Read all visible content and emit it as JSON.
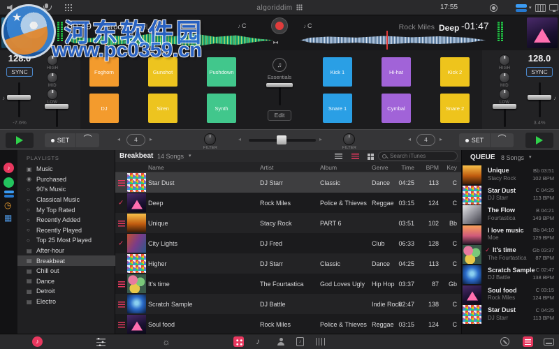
{
  "accent_color": "#e8385f",
  "watermark": {
    "line1": "河东软件园",
    "line2": "www.pc0359.cn"
  },
  "menubar": {
    "title": "algoriddim",
    "time": "17:55"
  },
  "deck_left": {
    "elapsed": "00:49",
    "title": "Groove",
    "artist": "Joel",
    "key": "C",
    "bpm": "128.0",
    "sync_label": "SYNC",
    "tempo_percent": "-7.6%",
    "eq_labels": [
      "HIGH",
      "MID",
      "LOW"
    ],
    "filter_label": "FILTER",
    "set_label": "SET",
    "loop_beats": "4",
    "art": "generic",
    "pads": [
      {
        "label": "Foghorn",
        "color": "#f39b2d"
      },
      {
        "label": "Gunshot",
        "color": "#edc41f"
      },
      {
        "label": "Pushdown",
        "color": "#41c78c"
      },
      {
        "label": "DJ",
        "color": "#f39b2d"
      },
      {
        "label": "Siren",
        "color": "#edc41f"
      },
      {
        "label": "Synth",
        "color": "#41c78c"
      }
    ]
  },
  "deck_right": {
    "remaining": "-01:47",
    "title": "Deep",
    "artist": "Rock Miles",
    "key": "C",
    "bpm": "128.0",
    "sync_label": "SYNC",
    "tempo_percent": "3.4%",
    "eq_labels": [
      "HIGH",
      "MID",
      "LOW"
    ],
    "filter_label": "FILTER",
    "set_label": "SET",
    "loop_beats": "4",
    "art": "pyramid",
    "pads": [
      {
        "label": "Kick 1",
        "color": "#2a9fe5"
      },
      {
        "label": "Hi-hat",
        "color": "#a163d8"
      },
      {
        "label": "Kick 2",
        "color": "#eec41c"
      },
      {
        "label": "Snare 1",
        "color": "#2a9fe5"
      },
      {
        "label": "Cymbal",
        "color": "#a163d8"
      },
      {
        "label": "Snare 2",
        "color": "#eec41c"
      }
    ]
  },
  "fx": {
    "name": "Essentials",
    "edit_label": "Edit"
  },
  "sidebar": {
    "header": "PLAYLISTS",
    "items": [
      {
        "label": "Music",
        "icon": "media"
      },
      {
        "label": "Purchased",
        "icon": "purchased"
      },
      {
        "label": "90's Music",
        "icon": "smart"
      },
      {
        "label": "Classical Music",
        "icon": "smart"
      },
      {
        "label": "My Top Rated",
        "icon": "smart"
      },
      {
        "label": "Recently Added",
        "icon": "smart"
      },
      {
        "label": "Recently Played",
        "icon": "smart"
      },
      {
        "label": "Top 25 Most Played",
        "icon": "smart"
      },
      {
        "label": "After-hour",
        "icon": "playlist"
      },
      {
        "label": "Breakbeat",
        "icon": "playlist",
        "selected": true
      },
      {
        "label": "Chill out",
        "icon": "playlist"
      },
      {
        "label": "Dance",
        "icon": "playlist"
      },
      {
        "label": "Detroit",
        "icon": "playlist"
      },
      {
        "label": "Electro",
        "icon": "playlist"
      }
    ]
  },
  "library": {
    "title": "Breakbeat",
    "count": "14 Songs",
    "search_placeholder": "Search iTunes",
    "columns": [
      "Name",
      "Artist",
      "Album",
      "Genre",
      "Time",
      "BPM",
      "Key"
    ],
    "rows": [
      {
        "status": "queue",
        "art": "confetti",
        "name": "Star Dust",
        "artist": "DJ Starr",
        "album": "Classic",
        "genre": "Dance",
        "time": "04:25",
        "bpm": "113",
        "key": "C",
        "selected": true
      },
      {
        "status": "check",
        "art": "pyramid",
        "name": "Deep",
        "artist": "Rock Miles",
        "album": "Police & Thieves",
        "genre": "Reggae",
        "time": "03:15",
        "bpm": "124",
        "key": "C"
      },
      {
        "status": "queue",
        "art": "concert",
        "name": "Unique",
        "artist": "Stacy Rock",
        "album": "PART 6",
        "genre": "",
        "time": "03:51",
        "bpm": "102",
        "key": "Bb"
      },
      {
        "status": "check",
        "art": "crowd",
        "name": "City Lights",
        "artist": "DJ Fred",
        "album": "",
        "genre": "Club",
        "time": "06:33",
        "bpm": "128",
        "key": "C"
      },
      {
        "status": "none",
        "art": "confetti",
        "name": "Higher",
        "artist": "DJ Starr",
        "album": "Classic",
        "genre": "Dance",
        "time": "04:25",
        "bpm": "113",
        "key": "C"
      },
      {
        "status": "queue",
        "art": "blobs",
        "name": "It's time",
        "artist": "The Fourtastica",
        "album": "God Loves Ugly",
        "genre": "Hip Hop",
        "time": "03:37",
        "bpm": "87",
        "key": "Gb"
      },
      {
        "status": "queue",
        "art": "bird",
        "name": "Scratch Sample",
        "artist": "DJ Battle",
        "album": "",
        "genre": "Indie Rock",
        "time": "02:47",
        "bpm": "138",
        "key": "C"
      },
      {
        "status": "queue",
        "art": "pyramid",
        "name": "Soul food",
        "artist": "Rock Miles",
        "album": "Police & Thieves",
        "genre": "Reggae",
        "time": "03:15",
        "bpm": "124",
        "key": "C"
      }
    ]
  },
  "queue": {
    "title": "QUEUE",
    "count": "8 Songs",
    "items": [
      {
        "art": "concert",
        "title": "Unique",
        "artist": "Stacy Rock",
        "key": "Bb",
        "time": "03:51",
        "bpm": "102"
      },
      {
        "art": "confetti",
        "title": "Star Dust",
        "artist": "DJ Starr",
        "key": "C",
        "time": "04:25",
        "bpm": "113"
      },
      {
        "art": "splash",
        "title": "The Flow",
        "artist": "Fourtastica",
        "key": "B",
        "time": "04:21",
        "bpm": "149"
      },
      {
        "art": "palms",
        "title": "I love music",
        "artist": "Moe",
        "key": "Bb",
        "time": "04:10",
        "bpm": "129"
      },
      {
        "art": "blobs",
        "title": "It's time",
        "artist": "The Fourtastica",
        "key": "Gb",
        "time": "03:37",
        "bpm": "87",
        "checked": true
      },
      {
        "art": "bird",
        "title": "Scratch Sample",
        "artist": "DJ Battle",
        "key": "C",
        "time": "02:47",
        "bpm": "138"
      },
      {
        "art": "pyramid",
        "title": "Soul food",
        "artist": "Rock Miles",
        "key": "C",
        "time": "03:15",
        "bpm": "124"
      },
      {
        "art": "confetti",
        "title": "Star Dust",
        "artist": "DJ Starr",
        "key": "C",
        "time": "04:25",
        "bpm": "113"
      }
    ]
  }
}
